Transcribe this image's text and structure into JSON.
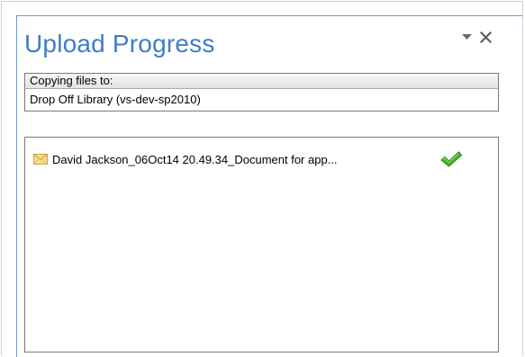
{
  "pane": {
    "title": "Upload Progress"
  },
  "destination": {
    "label": "Copying files to:",
    "value": "Drop Off Library (vs-dev-sp2010)"
  },
  "files": [
    {
      "name": "David Jackson_06Oct14 20.49.34_Document for app...",
      "type_icon": "email-envelope-icon",
      "status_icon": "checkmark-icon",
      "status": "complete"
    }
  ],
  "colors": {
    "title": "#3f7cc9",
    "pane_border": "#6e9bd6",
    "check": "#3fae2a",
    "envelope": "#f2d27a"
  }
}
